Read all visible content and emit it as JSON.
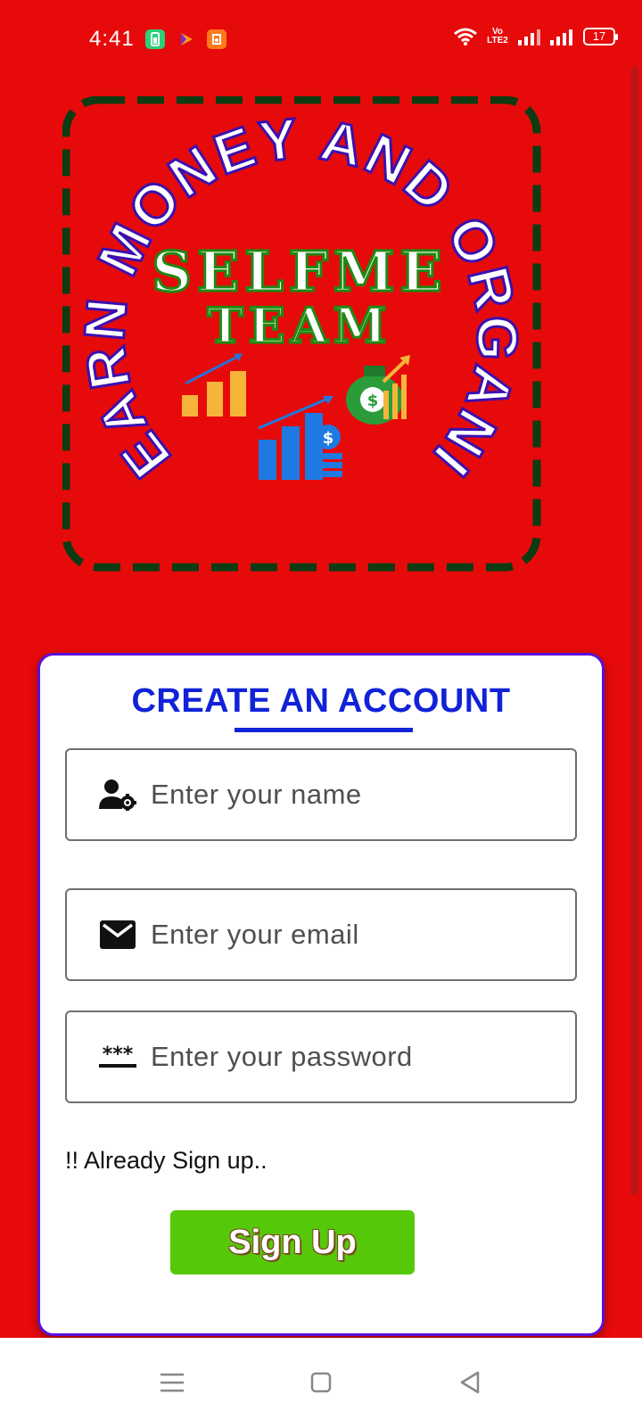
{
  "status_bar": {
    "time": "4:41",
    "volte_label": "Vo LTE2",
    "battery": "17"
  },
  "logo": {
    "arc_text": "EARN MONEY AND ORGANIC TRAFFIC",
    "title_line1": "SELFME",
    "title_line2": "TEAM",
    "icons": [
      "coin-stacks-chart-icon",
      "money-bag-growth-icon",
      "bar-chart-dollar-icon"
    ]
  },
  "form": {
    "title": "CREATE AN ACCOUNT",
    "name_placeholder": "Enter your name",
    "email_placeholder": "Enter your email",
    "password_placeholder": "Enter your password",
    "already_signed_up": "!! Already Sign up..",
    "submit_label": "Sign Up"
  },
  "colors": {
    "background": "#e70a0a",
    "title_blue": "#1122d8",
    "card_border": "#5a10d8",
    "button_green": "#56c80a",
    "logo_dash": "#0d3b12"
  },
  "nav_bar": {
    "icons": [
      "menu-icon",
      "home-square-icon",
      "back-triangle-icon"
    ]
  }
}
